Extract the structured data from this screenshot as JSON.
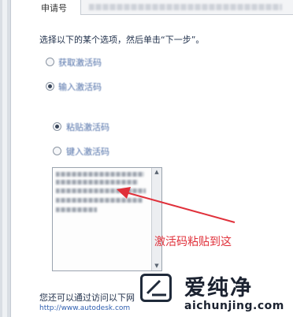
{
  "serial": {
    "label": "申请号"
  },
  "instruction": "选择以下的某个选项，然后单击“下一步”。",
  "options": {
    "get_code": {
      "label": "获取激活码",
      "checked": false
    },
    "enter_code": {
      "label": "输入激活码",
      "checked": true
    }
  },
  "sub_options": {
    "paste_code": {
      "label": "粘贴激活码",
      "checked": true
    },
    "type_code": {
      "label": "键入激活码",
      "checked": false
    }
  },
  "annotation": {
    "text": "激活码粘贴到这",
    "color": "#e0303a"
  },
  "footer": {
    "alt_text": "您还可以通过访问以下网",
    "url": "http://www.autodesk.com"
  },
  "watermark": {
    "brand": "爱纯净",
    "site": "aichunjing.com"
  }
}
